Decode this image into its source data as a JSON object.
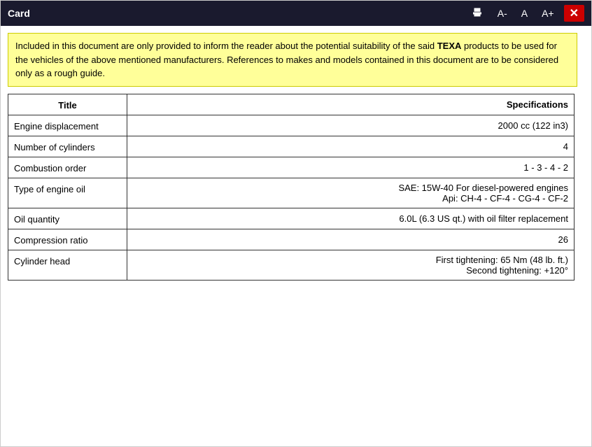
{
  "titleBar": {
    "title": "Card",
    "controls": {
      "print": "🖨",
      "fontDecrease": "A-",
      "fontNormal": "A",
      "fontIncrease": "A+",
      "close": "✕"
    }
  },
  "notice": {
    "text1": "Included in this document are only provided to inform the reader about the potential suitability of the said ",
    "brand": "TEXA",
    "text2": " products to be used for the vehicles of the above mentioned manufacturers. References to makes and models contained in this document are to be considered only as a rough guide."
  },
  "table": {
    "headers": {
      "title": "Title",
      "specifications": "Specifications"
    },
    "rows": [
      {
        "title": "Engine displacement",
        "spec": "2000 cc (122 in3)",
        "multiline": false
      },
      {
        "title": "Number of cylinders",
        "spec": "4",
        "multiline": false
      },
      {
        "title": "Combustion order",
        "spec": "1 - 3 - 4 - 2",
        "multiline": false
      },
      {
        "title": "Type of engine oil",
        "spec": [
          "SAE: 15W-40 For diesel-powered engines",
          "Api: CH-4 - CF-4 - CG-4 - CF-2"
        ],
        "multiline": true
      },
      {
        "title": "Oil quantity",
        "spec": "6.0L (6.3 US qt.) with oil filter replacement",
        "multiline": false
      },
      {
        "title": "Compression ratio",
        "spec": "26",
        "multiline": false
      },
      {
        "title": "Cylinder head",
        "spec": [
          "First tightening: 65 Nm (48 lb. ft.)",
          "Second tightening: +120°"
        ],
        "multiline": true,
        "partial": true
      }
    ]
  }
}
